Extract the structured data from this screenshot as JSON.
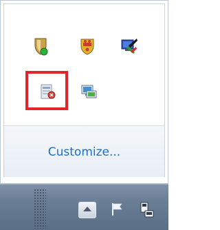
{
  "flyout": {
    "customize_label": "Customize..."
  },
  "tray_icons": [
    {
      "name": "security-shield-icon"
    },
    {
      "name": "crest-icon"
    },
    {
      "name": "display-settings-icon"
    },
    {
      "name": "remote-desktop-icon"
    },
    {
      "name": "network-icon"
    }
  ],
  "taskbar": {
    "icons": [
      {
        "name": "show-hidden-icons-icon"
      },
      {
        "name": "action-center-flag-icon"
      },
      {
        "name": "network-status-icon"
      }
    ]
  },
  "colors": {
    "link": "#1f6fc6",
    "highlight": "#e1252b",
    "taskbar": "#6a7e96"
  }
}
